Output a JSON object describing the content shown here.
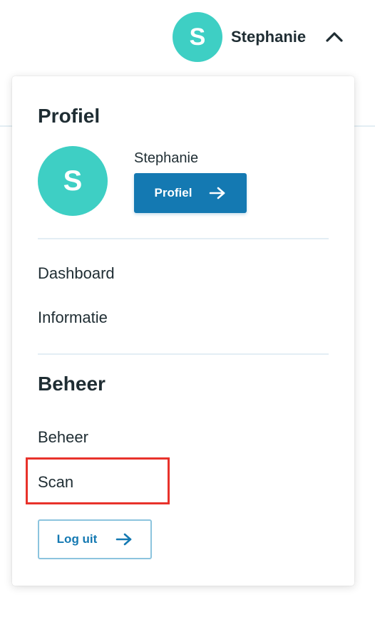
{
  "header": {
    "avatar_initial": "S",
    "user_name": "Stephanie",
    "toggle_icon": "chevron-up-icon"
  },
  "dropdown": {
    "profile_section": {
      "title": "Profiel",
      "avatar_initial": "S",
      "name": "Stephanie",
      "button_label": "Profiel",
      "button_icon": "arrow-right-icon"
    },
    "links": [
      {
        "label": "Dashboard"
      },
      {
        "label": "Informatie"
      }
    ],
    "admin_section": {
      "title": "Beheer",
      "links": [
        {
          "label": "Beheer"
        },
        {
          "label": "Scan"
        }
      ]
    },
    "logout": {
      "label": "Log uit",
      "icon": "arrow-right-icon"
    }
  },
  "colors": {
    "avatar": "#3ecfc4",
    "primary": "#1479b2",
    "text": "#1f2d33",
    "divider": "#e3eef4",
    "highlight": "#e8322b"
  }
}
